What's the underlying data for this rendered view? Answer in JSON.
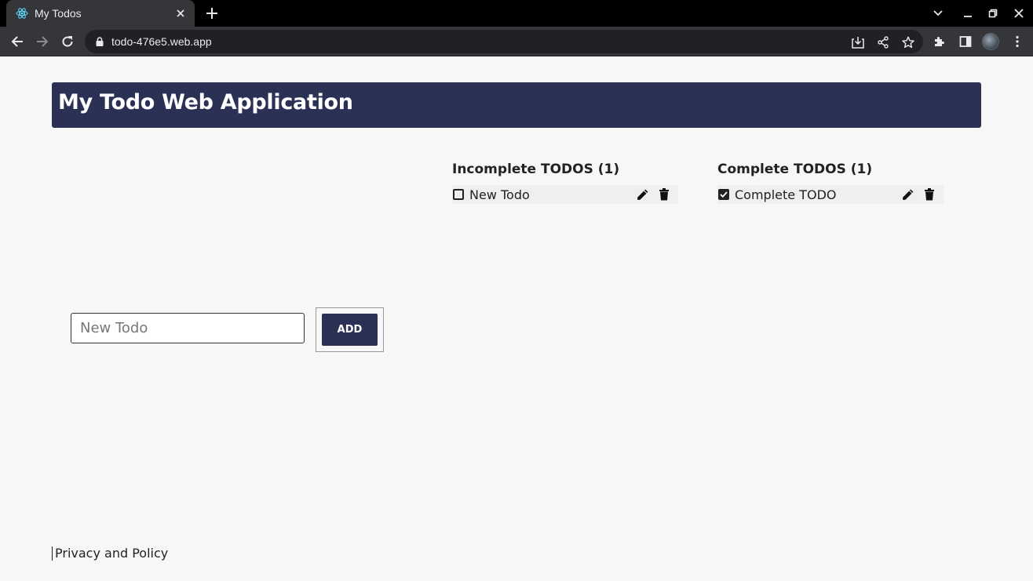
{
  "browser": {
    "tab_title": "My Todos",
    "url": "todo-476e5.web.app"
  },
  "app": {
    "title": "My Todo Web Application"
  },
  "incomplete": {
    "heading": "Incomplete TODOS (1)",
    "items": [
      {
        "text": "New Todo",
        "checked": false
      }
    ]
  },
  "complete": {
    "heading": "Complete TODOS (1)",
    "items": [
      {
        "text": "Complete TODO",
        "checked": true
      }
    ]
  },
  "form": {
    "placeholder": "New Todo",
    "value": "",
    "add_label": "ADD"
  },
  "footer": {
    "privacy_link": "Privacy and Policy"
  },
  "colors": {
    "header_bg": "#2a3155",
    "button_bg": "#2a3155",
    "page_bg": "#f7f7f7"
  }
}
